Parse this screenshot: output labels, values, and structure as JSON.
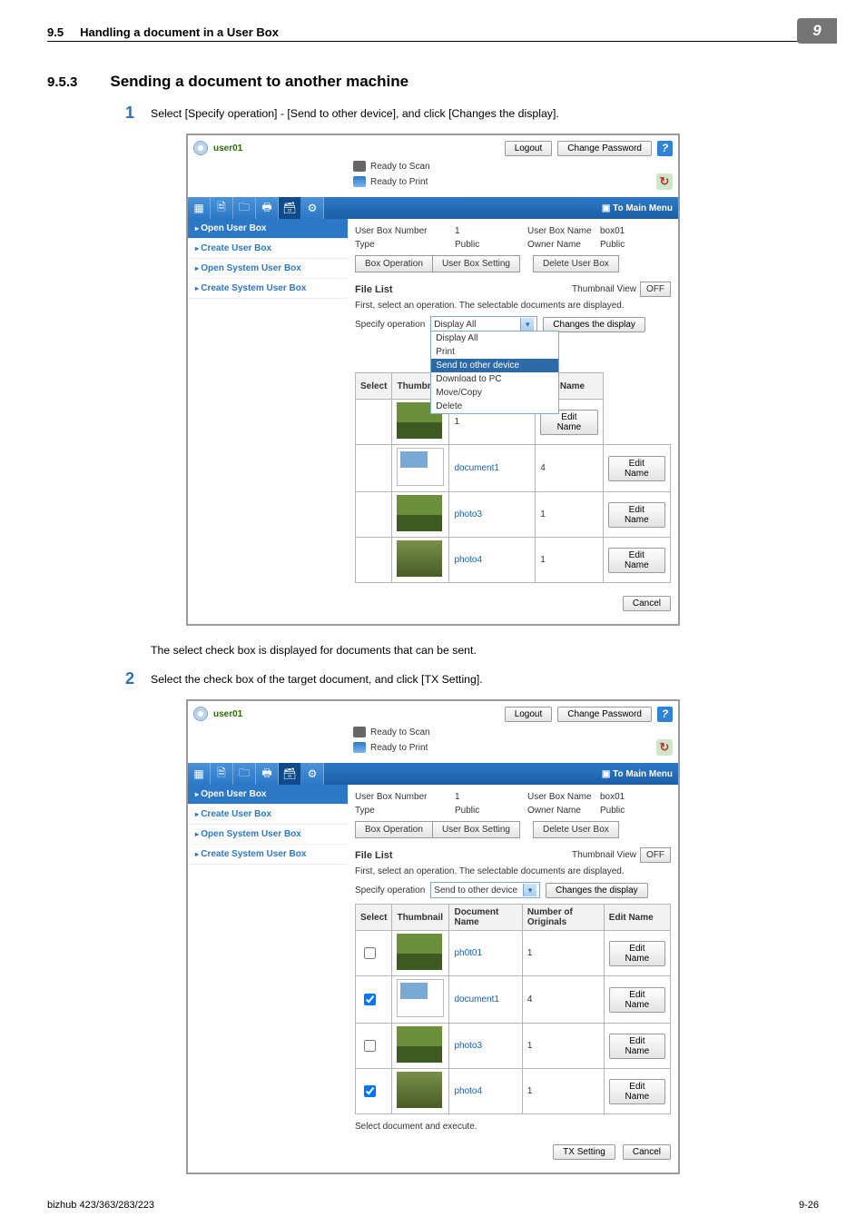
{
  "header": {
    "section_num": "9.5",
    "section_title": "Handling a document in a User Box",
    "chapter": "9"
  },
  "heading": {
    "num": "9.5.3",
    "title": "Sending a document to another machine"
  },
  "step1": {
    "num": "1",
    "text": "Select [Specify operation] - [Send to other device], and click [Changes the display]."
  },
  "caption1": "The select check box is displayed for documents that can be sent.",
  "step2": {
    "num": "2",
    "text": "Select the check box of the target document, and click [TX Setting]."
  },
  "shot_common": {
    "user": "user01",
    "logout": "Logout",
    "change_pw": "Change Password",
    "help": "?",
    "ready_scan": "Ready to Scan",
    "ready_print": "Ready to Print",
    "to_main": "To Main Menu",
    "sidebar": [
      "Open User Box",
      "Create User Box",
      "Open System User Box",
      "Create System User Box"
    ],
    "meta": {
      "ubn_lbl": "User Box Number",
      "ubn_val": "1",
      "ubname_lbl": "User Box Name",
      "ubname_val": "box01",
      "type_lbl": "Type",
      "type_val": "Public",
      "owner_lbl": "Owner Name",
      "owner_val": "Public"
    },
    "tabs": {
      "op": "Box Operation",
      "setting": "User Box Setting",
      "del": "Delete User Box"
    },
    "file_list": "File List",
    "thumb_view": "Thumbnail View",
    "off": "OFF",
    "instr": "First, select an operation. The selectable documents are displayed.",
    "spec_op": "Specify operation",
    "changes": "Changes the display",
    "col_select": "Select",
    "col_thumb": "Thumbnail",
    "col_docname": "Document Name",
    "col_numorig": "Number of Originals",
    "col_editname": "Edit Name",
    "edit_name_btn": "Edit Name",
    "cancel": "Cancel"
  },
  "shot1": {
    "dd_value": "Display All",
    "dd_options": [
      "Display All",
      "Print",
      "Send to other device",
      "Download to PC",
      "Move/Copy",
      "Delete"
    ],
    "dd_selected": "Send to other device",
    "rows": [
      {
        "name": "ph0t01",
        "orig": "1",
        "thumb": "landscape"
      },
      {
        "name": "document1",
        "orig": "4",
        "thumb": "doc"
      },
      {
        "name": "photo3",
        "orig": "1",
        "thumb": "landscape"
      },
      {
        "name": "photo4",
        "orig": "1",
        "thumb": "people"
      }
    ]
  },
  "shot2": {
    "dd_value": "Send to other device",
    "note": "Select document and execute.",
    "tx_setting": "TX Setting",
    "rows": [
      {
        "checked": false,
        "name": "ph0t01",
        "orig": "1",
        "thumb": "landscape"
      },
      {
        "checked": true,
        "name": "document1",
        "orig": "4",
        "thumb": "doc"
      },
      {
        "checked": false,
        "name": "photo3",
        "orig": "1",
        "thumb": "landscape"
      },
      {
        "checked": true,
        "name": "photo4",
        "orig": "1",
        "thumb": "people"
      }
    ]
  },
  "footer": {
    "model": "bizhub 423/363/283/223",
    "page": "9-26"
  },
  "chart_data": null
}
